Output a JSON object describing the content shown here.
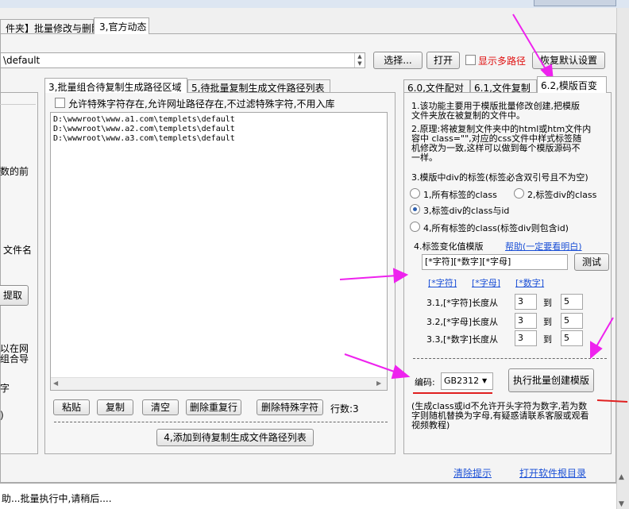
{
  "top_tabs": [
    "件夹】批量修改与删除",
    "3,官方动态"
  ],
  "path_bar": {
    "value": "\\default",
    "select_button": "选择...",
    "open_button": "打开",
    "show_multi_label": "显示多路径",
    "restore_button": "恢复默认设置"
  },
  "left_panel": {
    "texts": [
      "数的前",
      "文件名",
      "以在网",
      "组合导",
      "字",
      ")"
    ],
    "extract_button": "提取"
  },
  "middle_tabs": [
    "3,批量组合待复制生成路径区域",
    "5,待批量复制生成文件路径列表"
  ],
  "middle": {
    "allow_special_label": "允许特殊字符存在,允许网址路径存在,不过滤特殊字符,不用入库",
    "paths": [
      "D:\\wwwroot\\www.a1.com\\templets\\default",
      "D:\\wwwroot\\www.a2.com\\templets\\default",
      "D:\\wwwroot\\www.a3.com\\templets\\default"
    ],
    "buttons": [
      "粘贴",
      "复制",
      "清空",
      "删除重复行",
      "删除特殊字符"
    ],
    "row_count_label": "行数:3",
    "add_button": "4,添加到待复制生成文件路径列表"
  },
  "right_tabs": [
    "6.0,文件配对",
    "6.1,文件复制",
    "6.2,模版百变"
  ],
  "right": {
    "desc1": [
      "1.该功能主要用于模版批量修改创建,把模版",
      "文件夹放在被复制的文件中。"
    ],
    "desc2": [
      "2.原理:将被复制文件夹中的html或htm文件内",
      "容中  class=\"\",对应的css文件中样式标签随",
      "机修改为一致,这样可以做到每个模版源码不",
      "一样。"
    ],
    "desc3": "3.模版中div的标签(标签必含双引号且不为空)",
    "radios": [
      "1,所有标签的class",
      "2,标签div的class",
      "3,标签div的class与id",
      "4,所有标签的class(标签div则包含id)"
    ],
    "selected_radio": 2,
    "label4": "4.标签变化值模版",
    "help_link": "帮助(一定要看明白)",
    "template_value": "[*字符][*数字][*字母]",
    "test_button": "测试",
    "insert_links": [
      "[*字符]",
      "[*字母]",
      "[*数字]"
    ],
    "lengths": [
      {
        "label": "3.1,[*字符]长度从",
        "from": "3",
        "to_label": "到",
        "to": "5"
      },
      {
        "label": "3.2,[*字母]长度从",
        "from": "3",
        "to_label": "到",
        "to": "5"
      },
      {
        "label": "3.3,[*数字]长度从",
        "from": "3",
        "to_label": "到",
        "to": "5"
      }
    ],
    "encoding_label": "编码:",
    "encoding_value": "GB2312",
    "run_button": "执行批量创建模版",
    "note": [
      "(生成class或id不允许开头字符为数字,若为数",
      "字则随机替换为字母,有疑惑请联系客服或观看",
      "视频教程)"
    ]
  },
  "footer_links": [
    "清除提示",
    "打开软件根目录"
  ],
  "status_text": "助...批量执行中,请稍后....",
  "colors": {
    "annotation": "#ee22ee",
    "underline": "#e02020",
    "link": "#1a4fd6"
  }
}
